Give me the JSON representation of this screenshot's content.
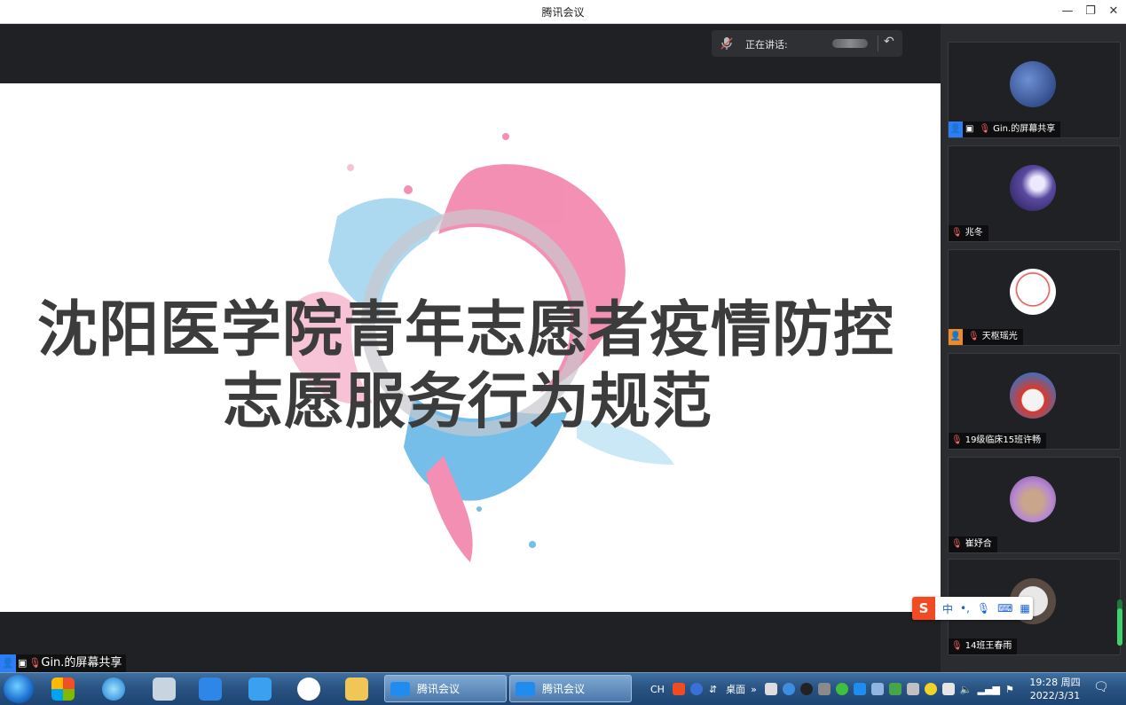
{
  "window": {
    "title": "腾讯会议"
  },
  "speaking": {
    "label": "正在讲话:"
  },
  "slide": {
    "line1": "沈阳医学院青年志愿者疫情防控",
    "line2": "志愿服务行为规范"
  },
  "presenter_tag": "Gin.的屏幕共享",
  "participants": [
    {
      "name": "Gin.的屏幕共享",
      "badge": "blue",
      "avatar_color": "#3a5ea8"
    },
    {
      "name": "兆冬",
      "badge": "",
      "avatar_color": "#3b2c74"
    },
    {
      "name": "天枢瑶光",
      "badge": "orange",
      "avatar_color": "#f2f2f2"
    },
    {
      "name": "19级临床15班许畅",
      "badge": "",
      "avatar_color": "#c8302a"
    },
    {
      "name": "崔妤合",
      "badge": "",
      "avatar_color": "#9a6fb8"
    },
    {
      "name": "14班王春雨",
      "badge": "",
      "avatar_color": "#d8d8d8"
    }
  ],
  "ime": {
    "logo": "S",
    "mode": "中"
  },
  "taskbar": {
    "items": [
      "腾讯会议",
      "腾讯会议"
    ],
    "lang": "CH",
    "desktop": "桌面",
    "time": "19:28 周四",
    "date": "2022/3/31"
  },
  "colors": {
    "accent_blue": "#2e7cf6",
    "badge_orange": "#f08a24",
    "ime_red": "#f04b23"
  }
}
